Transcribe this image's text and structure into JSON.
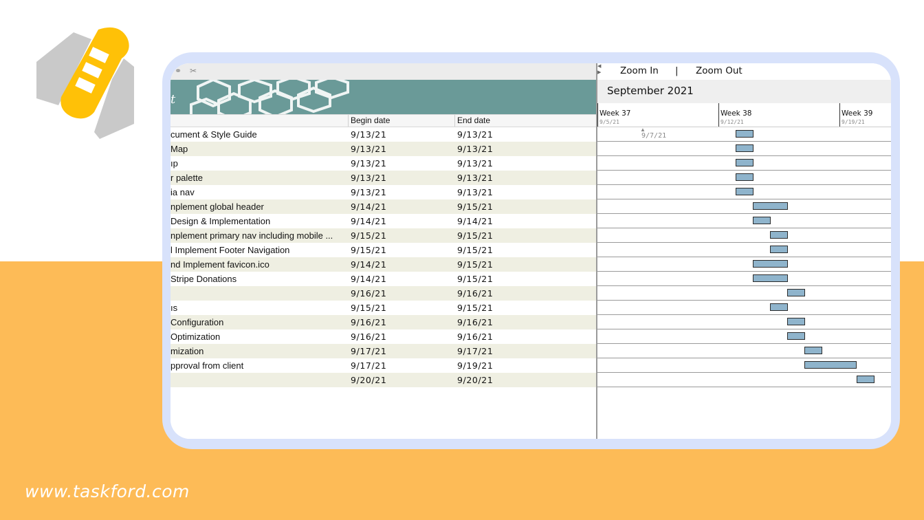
{
  "brand": {
    "url": "www.taskford.com",
    "colors": {
      "accent": "#fdbb57",
      "logo_yellow": "#ffc107",
      "logo_gray": "#c9c9c9",
      "frame": "#d8e2fb",
      "bar": "#8fb4cc",
      "banner": "#6a9a98"
    }
  },
  "toolbar": {
    "icons": [
      "link-icon",
      "unlink-icon"
    ]
  },
  "banner": {
    "text": "t"
  },
  "table": {
    "columns": {
      "name": "",
      "begin": "Begin date",
      "end": "End date"
    },
    "rows": [
      {
        "name": "cument & Style Guide",
        "begin": "9/13/21",
        "end": "9/13/21"
      },
      {
        "name": "Map",
        "begin": "9/13/21",
        "end": "9/13/21"
      },
      {
        "name": "ıp",
        "begin": "9/13/21",
        "end": "9/13/21"
      },
      {
        "name": "r palette",
        "begin": "9/13/21",
        "end": "9/13/21"
      },
      {
        "name": "ia nav",
        "begin": "9/13/21",
        "end": "9/13/21"
      },
      {
        "name": "nplement global header",
        "begin": "9/14/21",
        "end": "9/15/21"
      },
      {
        "name": "Design & Implementation",
        "begin": "9/14/21",
        "end": "9/14/21"
      },
      {
        "name": "nplement primary nav including mobile ...",
        "begin": "9/15/21",
        "end": "9/15/21"
      },
      {
        "name": "l Implement Footer Navigation",
        "begin": "9/15/21",
        "end": "9/15/21"
      },
      {
        "name": "nd Implement favicon.ico",
        "begin": "9/14/21",
        "end": "9/15/21"
      },
      {
        "name": "Stripe Donations",
        "begin": "9/14/21",
        "end": "9/15/21"
      },
      {
        "name": "",
        "begin": "9/16/21",
        "end": "9/16/21"
      },
      {
        "name": "ıs",
        "begin": "9/15/21",
        "end": "9/15/21"
      },
      {
        "name": "Configuration",
        "begin": "9/16/21",
        "end": "9/16/21"
      },
      {
        "name": "Optimization",
        "begin": "9/16/21",
        "end": "9/16/21"
      },
      {
        "name": "mization",
        "begin": "9/17/21",
        "end": "9/17/21"
      },
      {
        "name": "pproval from client",
        "begin": "9/17/21",
        "end": "9/19/21"
      },
      {
        "name": "",
        "begin": "9/20/21",
        "end": "9/20/21"
      }
    ]
  },
  "gantt": {
    "zoom_in": "Zoom In",
    "separator": "|",
    "zoom_out": "Zoom Out",
    "month": "September 2021",
    "weeks": [
      {
        "name": "Week 37",
        "date": "9/5/21"
      },
      {
        "name": "Week 38",
        "date": "9/12/21"
      },
      {
        "name": "Week 39",
        "date": "9/19/21"
      }
    ],
    "today_label": "9/7/21",
    "timeline_start": "9/5/21"
  }
}
